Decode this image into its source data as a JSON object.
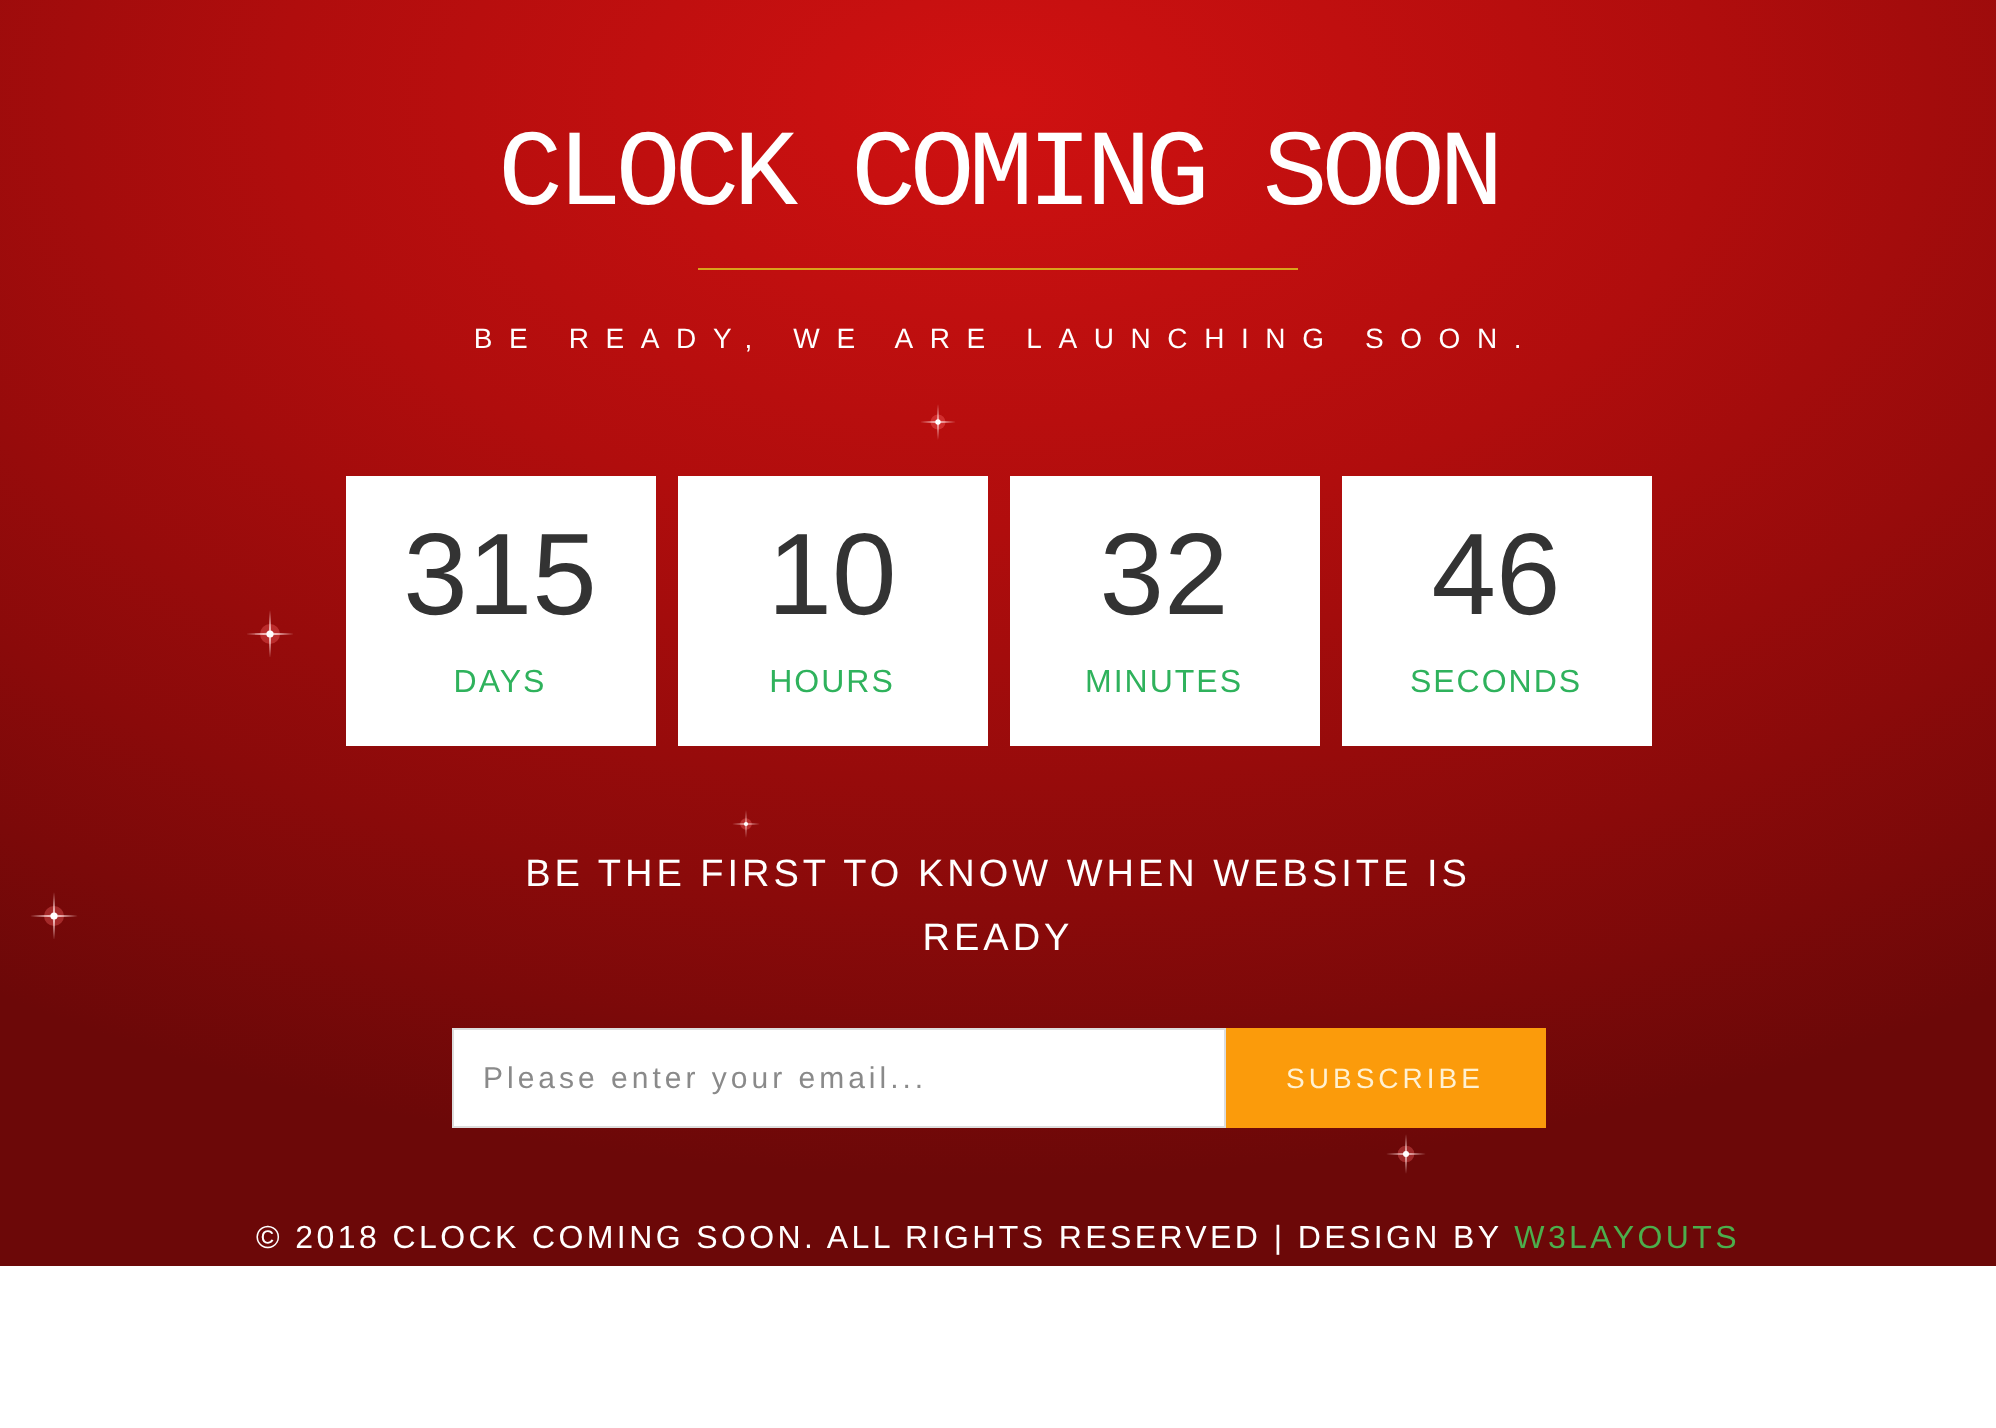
{
  "header": {
    "title": "CLOCK COMING SOON",
    "tagline": "BE READY, WE ARE LAUNCHING SOON."
  },
  "countdown": [
    {
      "value": "315",
      "unit": "DAYS"
    },
    {
      "value": "10",
      "unit": "HOURS"
    },
    {
      "value": "32",
      "unit": "MINUTES"
    },
    {
      "value": "46",
      "unit": "SECONDS"
    }
  ],
  "signup": {
    "heading": "BE THE FIRST TO KNOW WHEN WEBSITE IS READY",
    "email_field": {
      "placeholder": "Please enter your email..."
    },
    "button": "SUBSCRIBE"
  },
  "footer": {
    "text": "© 2018 CLOCK COMING SOON. ALL RIGHTS RESERVED | DESIGN BY",
    "link": "W3LAYOUTS"
  }
}
